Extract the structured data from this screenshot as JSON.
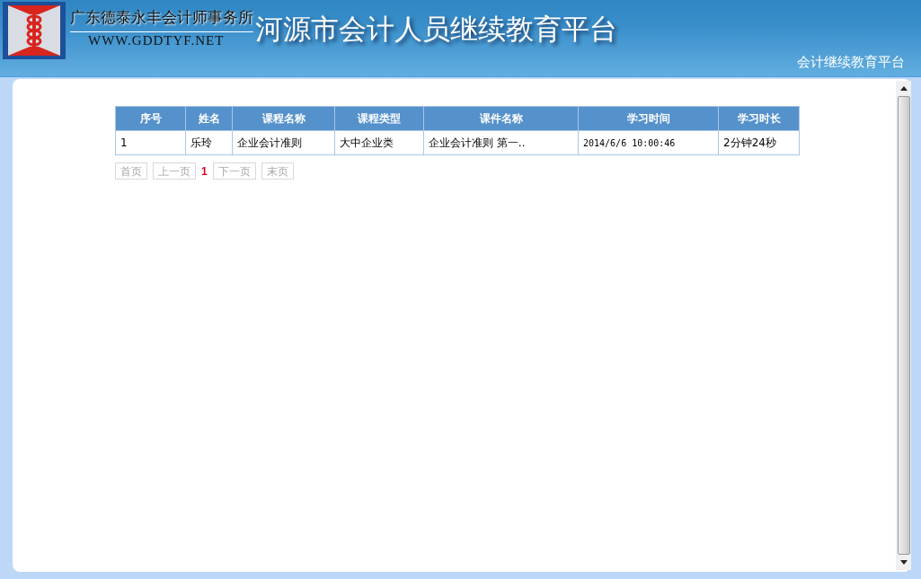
{
  "header": {
    "company": "广东德泰永丰会计师事务所",
    "website": "WWW.GDDTYF.NET",
    "title": "河源市会计人员继续教育平台",
    "subtitle": "会计继续教育平台"
  },
  "table": {
    "columns": [
      "序号",
      "姓名",
      "课程名称",
      "课程类型",
      "课件名称",
      "学习时间",
      "学习时长"
    ],
    "rows": [
      [
        "1",
        "乐玲",
        "企业会计准则",
        "大中企业类",
        "企业会计准则 第一..",
        "2014/6/6 10:00:46",
        "2分钟24秒"
      ]
    ]
  },
  "pager": [
    {
      "label": "首页",
      "kind": "button",
      "disabled": true
    },
    {
      "label": "上一页",
      "kind": "button",
      "disabled": true
    },
    {
      "label": "1",
      "kind": "current"
    },
    {
      "label": "下一页",
      "kind": "button",
      "disabled": true
    },
    {
      "label": "末页",
      "kind": "button",
      "disabled": true
    }
  ]
}
